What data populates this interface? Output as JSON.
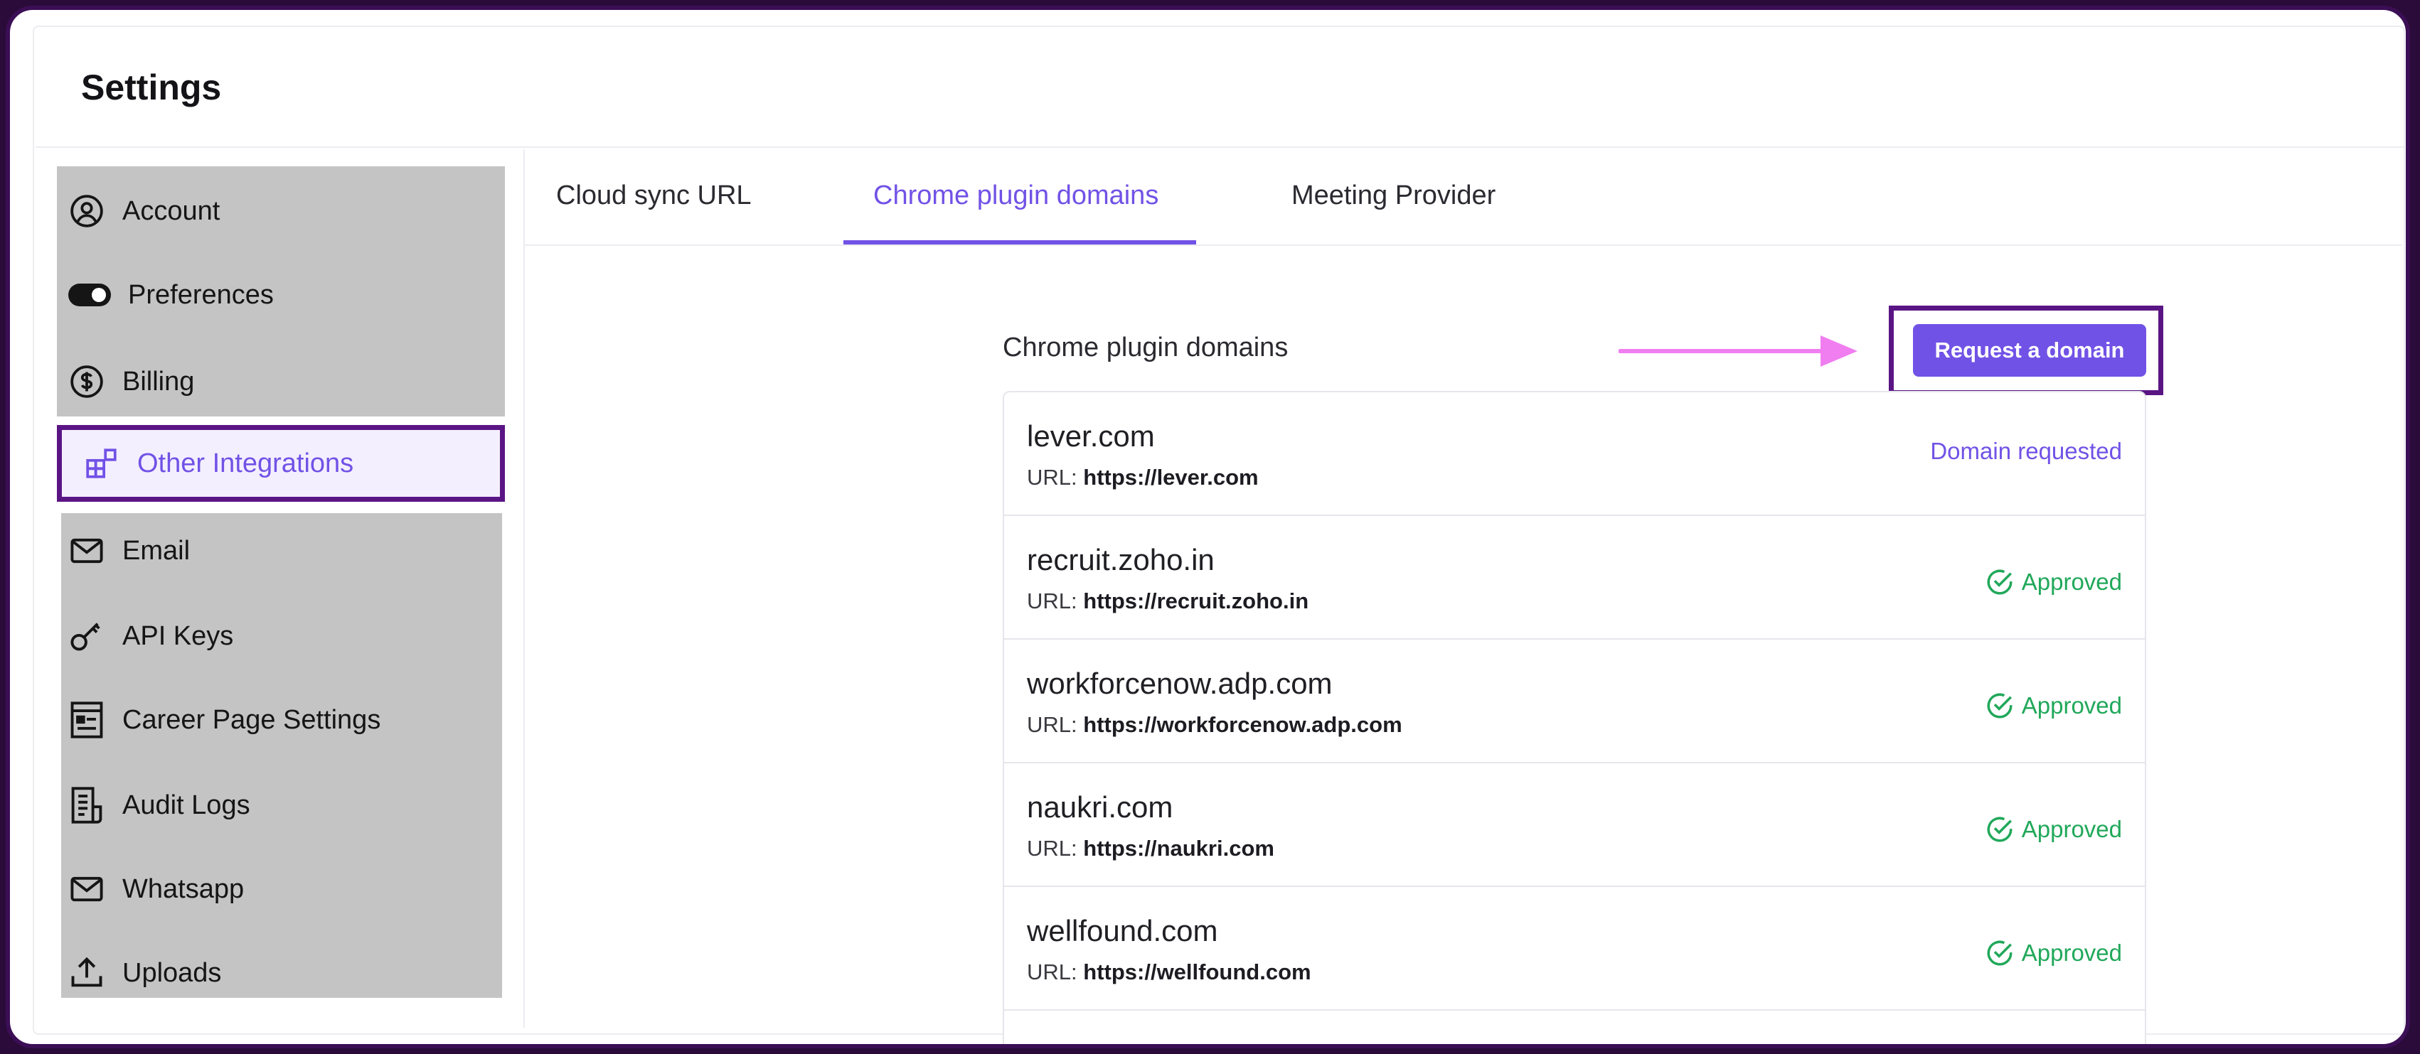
{
  "page": {
    "title": "Settings"
  },
  "sidebar": {
    "items": [
      {
        "label": "Account",
        "icon": "user-circle-icon"
      },
      {
        "label": "Preferences",
        "icon": "toggle-icon"
      },
      {
        "label": "Billing",
        "icon": "dollar-circle-icon"
      },
      {
        "label": "Other Integrations",
        "icon": "integrations-icon",
        "active": true
      },
      {
        "label": "Email",
        "icon": "mail-icon"
      },
      {
        "label": "API Keys",
        "icon": "key-icon"
      },
      {
        "label": "Career Page Settings",
        "icon": "page-layout-icon"
      },
      {
        "label": "Audit Logs",
        "icon": "document-list-icon"
      },
      {
        "label": "Whatsapp",
        "icon": "mail-icon"
      },
      {
        "label": "Uploads",
        "icon": "upload-icon"
      }
    ]
  },
  "tabs": [
    {
      "label": "Cloud sync URL"
    },
    {
      "label": "Chrome plugin domains",
      "active": true
    },
    {
      "label": "Meeting Provider"
    }
  ],
  "content": {
    "section_title": "Chrome plugin domains",
    "request_button": "Request a domain",
    "url_prefix": "URL:",
    "domains": [
      {
        "name": "lever.com",
        "url": "https://lever.com",
        "status": "Domain requested"
      },
      {
        "name": "recruit.zoho.in",
        "url": "https://recruit.zoho.in",
        "status": "Approved"
      },
      {
        "name": "workforcenow.adp.com",
        "url": "https://workforcenow.adp.com",
        "status": "Approved"
      },
      {
        "name": "naukri.com",
        "url": "https://naukri.com",
        "status": "Approved"
      },
      {
        "name": "wellfound.com",
        "url": "https://wellfound.com",
        "status": "Approved"
      }
    ]
  },
  "colors": {
    "accent": "#7152e6",
    "highlight_border": "#5a1585",
    "approved": "#21a85a",
    "annotation_arrow": "#f07ef0"
  }
}
